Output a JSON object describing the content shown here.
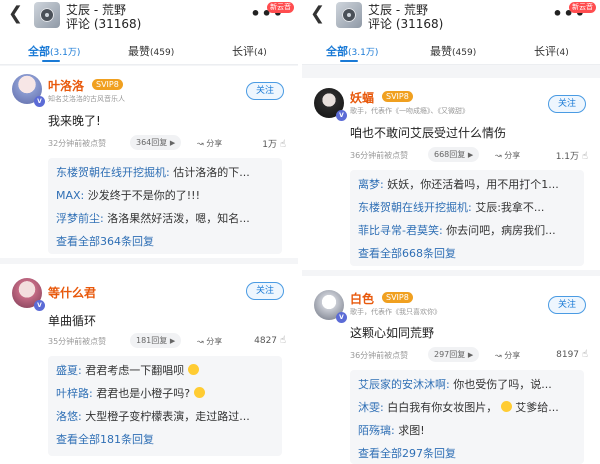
{
  "colors": {
    "accent": "#1a7ad6",
    "username": "#e8590c",
    "reply_name": "#2f6fb5",
    "vip_badge": "#f0a020"
  },
  "panels": [
    {
      "header": {
        "back_icon": "chevron-left-icon",
        "title": "艾辰 - 荒野",
        "subtitle": "评论 (31168)",
        "more_icon": "more-dots-icon",
        "badge": "新云音"
      },
      "tabs": [
        {
          "label": "全部",
          "count": "(3.1万)",
          "active": true
        },
        {
          "label": "最赞",
          "count": "(459)",
          "active": false
        },
        {
          "label": "长评",
          "count": "(4)",
          "active": false
        }
      ],
      "comments": [
        {
          "user": "叶洛洛",
          "vip": "SVIP",
          "vip_level": "8",
          "sub": "知名艾洛洛的古风音乐人",
          "follow": "关注",
          "text": "我来晚了!",
          "time": "32分钟前被点赞",
          "reply_count": "364回复",
          "share": "分享",
          "likes": "1万",
          "replies": [
            {
              "name": "东楼贺朝在线开挖掘机:",
              "text": " 估计洛洛的下..."
            },
            {
              "name": "MAX:",
              "text": " 沙发终于不是你的了!!!"
            },
            {
              "name": "浮梦前尘:",
              "text": " 洛洛果然好活泼，嗯，知名..."
            }
          ],
          "view_all": "查看全部364条回复"
        },
        {
          "user": "等什么君",
          "vip": "",
          "vip_level": "",
          "sub": "",
          "follow": "关注",
          "text": "单曲循环",
          "time": "35分钟前被点赞",
          "reply_count": "181回复",
          "share": "分享",
          "likes": "4827",
          "replies": [
            {
              "name": "盛夏:",
              "text": " 君君考虑一下翻唱呗",
              "emoji": true
            },
            {
              "name": "叶梓路:",
              "text": " 君君也是小橙子吗?",
              "emoji": true
            },
            {
              "name": "洛悠:",
              "text": " 大型橙子变柠檬表演，走过路过..."
            }
          ],
          "view_all": "查看全部181条回复"
        }
      ]
    },
    {
      "header": {
        "back_icon": "chevron-left-icon",
        "title": "艾辰 - 荒野",
        "subtitle": "评论 (31168)",
        "more_icon": "more-dots-icon",
        "badge": "新云音"
      },
      "tabs": [
        {
          "label": "全部",
          "count": "(3.1万)",
          "active": true
        },
        {
          "label": "最赞",
          "count": "(459)",
          "active": false
        },
        {
          "label": "长评",
          "count": "(4)",
          "active": false
        }
      ],
      "comments": [
        {
          "user": "妖蝠",
          "vip": "SVIP",
          "vip_level": "8",
          "sub": "歌手，代表作《一吻成瘾》、《又微甜》",
          "follow": "关注",
          "text": "咱也不敢问艾辰受过什么情伤",
          "time": "36分钟前被点赞",
          "reply_count": "668回复",
          "share": "分享",
          "likes": "1.1万",
          "replies": [
            {
              "name": "离梦:",
              "text": " 妖妖，你还活着吗，用不用打个1..."
            },
            {
              "name": "东楼贺朝在线开挖掘机:",
              "text": " 艾辰:我拿不..."
            },
            {
              "name": "菲比寻常-君莫笑:",
              "text": " 你去问吧，病房我们..."
            }
          ],
          "view_all": "查看全部668条回复"
        },
        {
          "user": "白色",
          "vip": "SVIP",
          "vip_level": "8",
          "sub": "歌手，代表作《我只喜欢你》",
          "follow": "关注",
          "text": "这颗心如同荒野",
          "time": "36分钟前被点赞",
          "reply_count": "297回复",
          "share": "分享",
          "likes": "8197",
          "replies": [
            {
              "name": "艾辰家的安沐沐啊:",
              "text": " 你也受伤了吗，说..."
            },
            {
              "name": "沐雯:",
              "text": " 白白我有你女妆图片，",
              "emoji": true,
              "tail": " 艾爹给..."
            },
            {
              "name": "陌殇璃:",
              "text": " 求图!"
            }
          ],
          "view_all": "查看全部297条回复"
        }
      ]
    }
  ]
}
